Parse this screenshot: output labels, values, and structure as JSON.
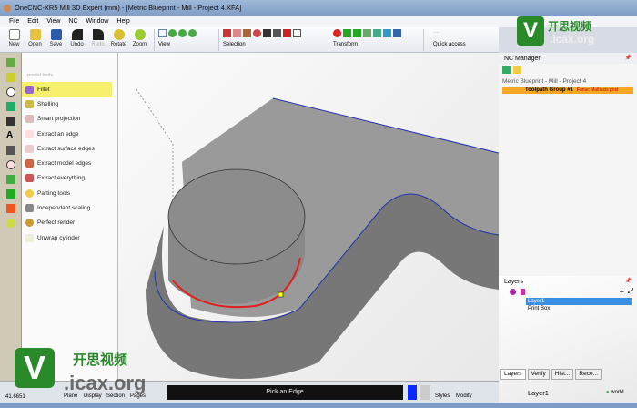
{
  "window": {
    "title": "OneCNC-XR5 Mill 3D Expert (mm) - [Metric Blueprint - Mill - Project 4.XFA]"
  },
  "menu": [
    "File",
    "Edit",
    "View",
    "NC",
    "Window",
    "Help"
  ],
  "toolbar": {
    "buttons": [
      "New",
      "Open",
      "Save",
      "Undo",
      "Redo",
      "Rotate",
      "Zoom"
    ],
    "groups": [
      "View",
      "Selection",
      "Transform",
      "Quick access"
    ]
  },
  "tools": {
    "header": "model tools",
    "items": [
      "Fillet",
      "Shelling",
      "Smart projection",
      "Extract an edge",
      "Extract surface edges",
      "Extract model edges",
      "Extract everything",
      "Parting tools",
      "Independant scaling",
      "Perfect render",
      "Unwrap cylinder"
    ],
    "selected": 0
  },
  "nc_manager": {
    "title": "NC Manager",
    "project": "Metric Blueprint - Mill - Project 4",
    "toolpath_group": "Toolpath Group #1",
    "post": "Fanuc Multiaxis post"
  },
  "layers": {
    "title": "Layers",
    "items": [
      "Layer1",
      "Print Box"
    ],
    "tabs": [
      "Layers",
      "Verify",
      "Hist...",
      "Rece..."
    ],
    "current": "Layer1",
    "coord_system": "world"
  },
  "status": {
    "prompt": "Pick an Edge",
    "coord_z": "41.6651",
    "buttons": [
      "Plane",
      "Display",
      "Section",
      "Pages"
    ],
    "right_buttons": [
      "Styles",
      "Modify"
    ]
  },
  "watermark": {
    "chinese": "开思视频",
    "site": ".icax.org",
    "letter": "V"
  },
  "colors": {
    "accent": "#f5a623",
    "selection": "#3b8fe0",
    "highlight": "#f6f06c",
    "edge": "#e02020"
  }
}
